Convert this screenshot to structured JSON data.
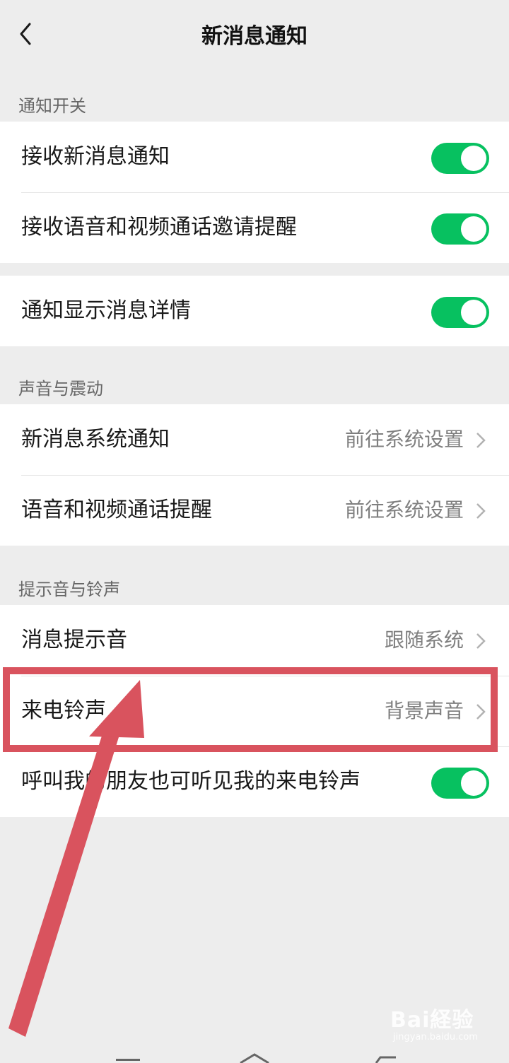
{
  "header": {
    "title": "新消息通知"
  },
  "sections": [
    {
      "title": "通知开关"
    },
    {
      "title": "声音与震动"
    },
    {
      "title": "提示音与铃声"
    }
  ],
  "rows": {
    "receive_new": {
      "label": "接收新消息通知",
      "on": true
    },
    "voice_video_invite": {
      "label": "接收语音和视频通话邀请提醒",
      "on": true
    },
    "show_details": {
      "label": "通知显示消息详情",
      "on": true
    },
    "system_notice": {
      "label": "新消息系统通知",
      "value": "前往系统设置"
    },
    "call_reminder": {
      "label": "语音和视频通话提醒",
      "value": "前往系统设置"
    },
    "message_tone": {
      "label": "消息提示音",
      "value": "跟随系统"
    },
    "ringtone": {
      "label": "来电铃声",
      "value": "背景声音"
    },
    "share_ringtone": {
      "label": "呼叫我的朋友也可听见我的来电铃声",
      "on": true
    }
  },
  "watermark": {
    "brand": "Bai経验",
    "sub": "jingyan.baidu.com"
  },
  "colors": {
    "accent": "#07c160",
    "annotation": "#d9535e",
    "background": "#ededed"
  }
}
